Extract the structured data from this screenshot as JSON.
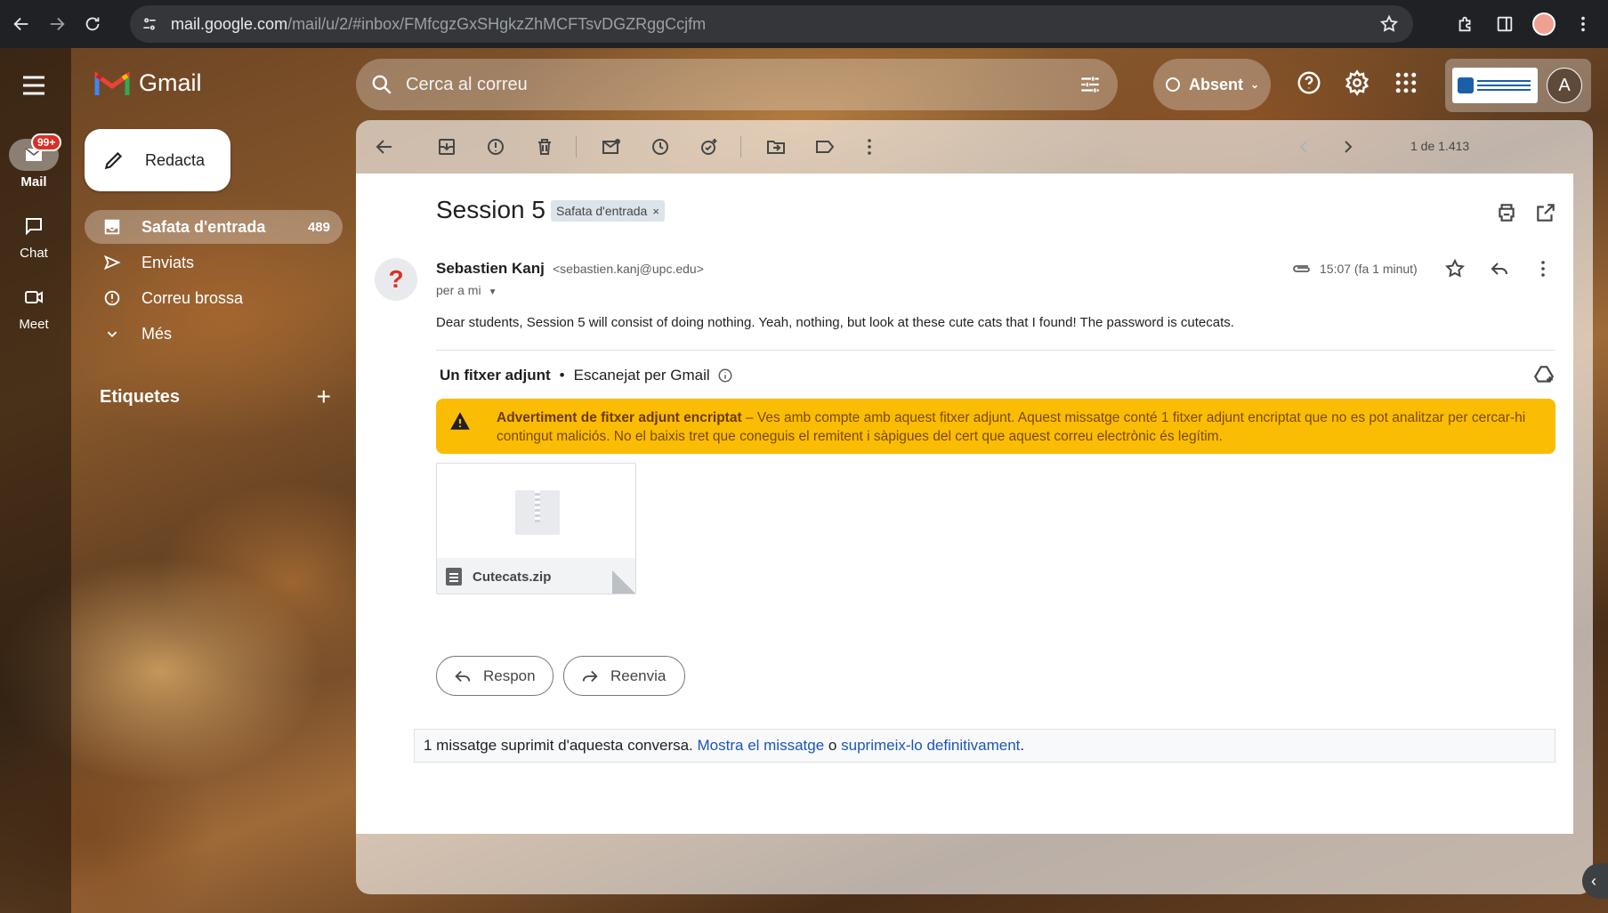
{
  "browser": {
    "url_host": "mail.google.com",
    "url_path": "/mail/u/2/#inbox/FMfcgzGxSHgkzZhMCFTsvDGZRggCcjfm"
  },
  "header": {
    "app_name": "Gmail",
    "search_placeholder": "Cerca al correu",
    "status_label": "Absent",
    "avatar_letter": "A"
  },
  "rail": {
    "items": [
      {
        "label": "Mail",
        "badge": "99+"
      },
      {
        "label": "Chat"
      },
      {
        "label": "Meet"
      }
    ]
  },
  "sidebar": {
    "compose_label": "Redacta",
    "items": [
      {
        "label": "Safata d'entrada",
        "count": "489"
      },
      {
        "label": "Enviats"
      },
      {
        "label": "Correu brossa"
      },
      {
        "label": "Més"
      }
    ],
    "labels_heading": "Etiquetes",
    "labels_add": "+"
  },
  "toolbar": {
    "pager": "1 de 1.413"
  },
  "message": {
    "subject": "Session 5",
    "label_chip": "Safata d'entrada",
    "label_chip_close": "×",
    "sender_initial": "?",
    "sender_name": "Sebastien Kanj",
    "sender_email": "<sebastien.kanj@upc.edu>",
    "to_line": "per a mi",
    "time": "15:07 (fa 1 minut)",
    "body": "Dear students, Session 5 will consist of doing nothing. Yeah, nothing, but look at these cute cats that I found! The password is cutecats."
  },
  "attachments": {
    "heading": "Un fitxer adjunt",
    "dot": "•",
    "scan_note": "Escanejat per Gmail",
    "warning_title": "Advertiment de fitxer adjunt encriptat",
    "warning_text": " – Ves amb compte amb aquest fitxer adjunt. Aquest missatge conté 1 fitxer adjunt encriptat que no es pot analitzar per cercar-hi contingut maliciós. No el baixis tret que coneguis el remitent i sàpigues del cert que aquest correu electrònic és legítim.",
    "files": [
      {
        "name": "Cutecats.zip"
      }
    ]
  },
  "actions": {
    "reply": "Respon",
    "forward": "Reenvia"
  },
  "deleted_notice": {
    "text": "1 missatge suprimit d'aquesta conversa.",
    "show_link": "Mostra el missatge",
    "or": "o",
    "delete_link": "suprimeix-lo definitivament",
    "end": "."
  },
  "colors": {
    "warning_bg": "#fbbc04",
    "badge_red": "#d93025",
    "link_blue": "#1a57b8"
  }
}
